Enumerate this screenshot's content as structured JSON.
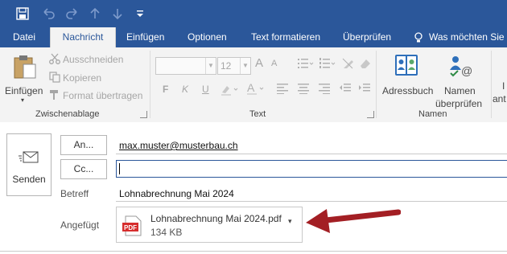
{
  "quick_access": {
    "save_icon": "save-icon",
    "undo_icon": "undo-icon",
    "redo_icon": "redo-icon",
    "up_icon": "arrow-up-icon",
    "down_icon": "arrow-down-icon",
    "customize_icon": "customize-icon"
  },
  "tabs": [
    {
      "label": "Datei"
    },
    {
      "label": "Nachricht"
    },
    {
      "label": "Einfügen"
    },
    {
      "label": "Optionen"
    },
    {
      "label": "Text formatieren"
    },
    {
      "label": "Überprüfen"
    },
    {
      "label": "Was möchten Sie t"
    }
  ],
  "ribbon": {
    "clipboard": {
      "paste": "Einfügen",
      "cut": "Ausschneiden",
      "copy": "Kopieren",
      "format_painter": "Format übertragen",
      "group": "Zwischenablage"
    },
    "text": {
      "font_size": "12",
      "bold": "F",
      "italic": "K",
      "underline": "U",
      "grow": "A",
      "shrink": "A",
      "group": "Text"
    },
    "names": {
      "address_book": "Adressbuch",
      "check_names_line1": "Namen",
      "check_names_line2": "überprüfen",
      "group": "Namen"
    },
    "cut_off_line1": "I",
    "cut_off_line2": "ant"
  },
  "compose": {
    "send": "Senden",
    "to_button": "An...",
    "cc_button": "Cc...",
    "to_value": "max.muster@musterbau.ch",
    "cc_value": "",
    "subject_label": "Betreff",
    "subject_value": "Lohnabrechnung Mai 2024",
    "attached_label": "Angefügt",
    "attachment": {
      "name": "Lohnabrechnung Mai 2024.pdf",
      "size": "134 KB",
      "type_badge": "PDF"
    }
  },
  "colors": {
    "brand_blue": "#2b579a",
    "arrow_red": "#a31f24",
    "pdf_red": "#d62d2d"
  }
}
